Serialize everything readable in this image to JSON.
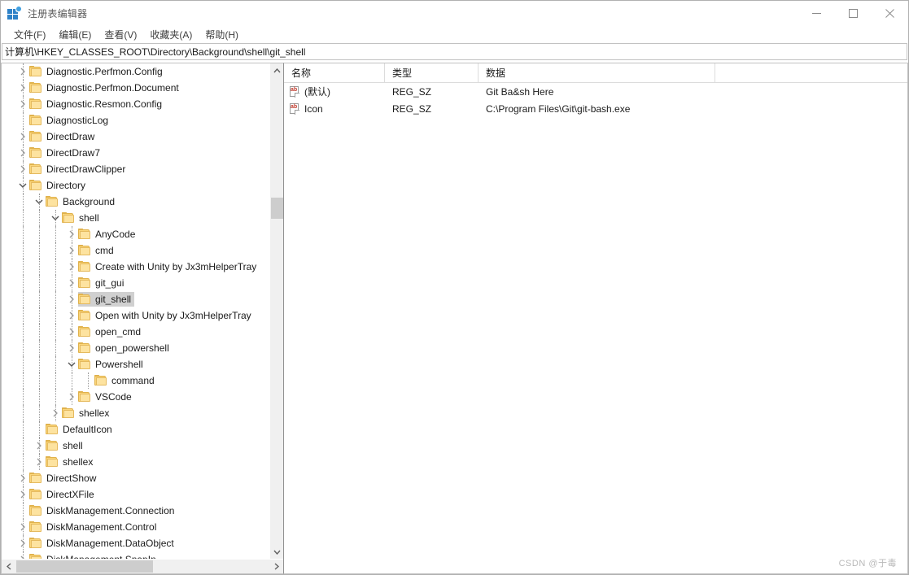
{
  "window": {
    "title": "注册表编辑器",
    "icon": "registry-editor-icon",
    "minimize_label": "—",
    "maximize_label": "□",
    "close_label": "✕"
  },
  "menubar": {
    "items": [
      {
        "label": "文件(F)",
        "name": "menu-file"
      },
      {
        "label": "编辑(E)",
        "name": "menu-edit"
      },
      {
        "label": "查看(V)",
        "name": "menu-view"
      },
      {
        "label": "收藏夹(A)",
        "name": "menu-favorites"
      },
      {
        "label": "帮助(H)",
        "name": "menu-help"
      }
    ]
  },
  "address": {
    "value": "计算机\\HKEY_CLASSES_ROOT\\Directory\\Background\\shell\\git_shell"
  },
  "tree": {
    "nodes": [
      {
        "label": "Diagnostic.Perfmon.Config",
        "depth": 1,
        "state": "collapsed",
        "selected": false
      },
      {
        "label": "Diagnostic.Perfmon.Document",
        "depth": 1,
        "state": "collapsed",
        "selected": false
      },
      {
        "label": "Diagnostic.Resmon.Config",
        "depth": 1,
        "state": "collapsed",
        "selected": false
      },
      {
        "label": "DiagnosticLog",
        "depth": 1,
        "state": "leaf",
        "selected": false
      },
      {
        "label": "DirectDraw",
        "depth": 1,
        "state": "collapsed",
        "selected": false
      },
      {
        "label": "DirectDraw7",
        "depth": 1,
        "state": "collapsed",
        "selected": false
      },
      {
        "label": "DirectDrawClipper",
        "depth": 1,
        "state": "collapsed",
        "selected": false
      },
      {
        "label": "Directory",
        "depth": 1,
        "state": "expanded",
        "selected": false
      },
      {
        "label": "Background",
        "depth": 2,
        "state": "expanded",
        "selected": false
      },
      {
        "label": "shell",
        "depth": 3,
        "state": "expanded",
        "selected": false
      },
      {
        "label": "AnyCode",
        "depth": 4,
        "state": "collapsed",
        "selected": false
      },
      {
        "label": "cmd",
        "depth": 4,
        "state": "collapsed",
        "selected": false
      },
      {
        "label": "Create with Unity by Jx3mHelperTray",
        "depth": 4,
        "state": "collapsed",
        "selected": false
      },
      {
        "label": "git_gui",
        "depth": 4,
        "state": "collapsed",
        "selected": false
      },
      {
        "label": "git_shell",
        "depth": 4,
        "state": "collapsed",
        "selected": true
      },
      {
        "label": "Open with Unity by Jx3mHelperTray",
        "depth": 4,
        "state": "collapsed",
        "selected": false
      },
      {
        "label": "open_cmd",
        "depth": 4,
        "state": "collapsed",
        "selected": false
      },
      {
        "label": "open_powershell",
        "depth": 4,
        "state": "collapsed",
        "selected": false
      },
      {
        "label": "Powershell",
        "depth": 4,
        "state": "expanded",
        "selected": false
      },
      {
        "label": "command",
        "depth": 5,
        "state": "leaf",
        "selected": false
      },
      {
        "label": "VSCode",
        "depth": 4,
        "state": "collapsed",
        "selected": false
      },
      {
        "label": "shellex",
        "depth": 3,
        "state": "collapsed",
        "selected": false
      },
      {
        "label": "DefaultIcon",
        "depth": 2,
        "state": "leaf",
        "selected": false
      },
      {
        "label": "shell",
        "depth": 2,
        "state": "collapsed",
        "selected": false
      },
      {
        "label": "shellex",
        "depth": 2,
        "state": "collapsed",
        "selected": false
      },
      {
        "label": "DirectShow",
        "depth": 1,
        "state": "collapsed",
        "selected": false
      },
      {
        "label": "DirectXFile",
        "depth": 1,
        "state": "collapsed",
        "selected": false
      },
      {
        "label": "DiskManagement.Connection",
        "depth": 1,
        "state": "leaf",
        "selected": false
      },
      {
        "label": "DiskManagement.Control",
        "depth": 1,
        "state": "collapsed",
        "selected": false
      },
      {
        "label": "DiskManagement.DataObject",
        "depth": 1,
        "state": "collapsed",
        "selected": false
      },
      {
        "label": "DiskManagement.SnapIn",
        "depth": 1,
        "state": "collapsed",
        "selected": false
      }
    ]
  },
  "values": {
    "columns": [
      "名称",
      "类型",
      "数据"
    ],
    "rows": [
      {
        "name": "(默认)",
        "type": "REG_SZ",
        "data": "Git Ba&sh Here",
        "icon": "string-value-icon"
      },
      {
        "name": "Icon",
        "type": "REG_SZ",
        "data": "C:\\Program Files\\Git\\git-bash.exe",
        "icon": "string-value-icon"
      }
    ]
  },
  "watermark": {
    "text": "CSDN @于毒"
  },
  "colors": {
    "folder": "#fbd67b",
    "selection": "#d0d0d0",
    "accent": "#2e82c8",
    "scroll_thumb": "#cdcdcd"
  }
}
